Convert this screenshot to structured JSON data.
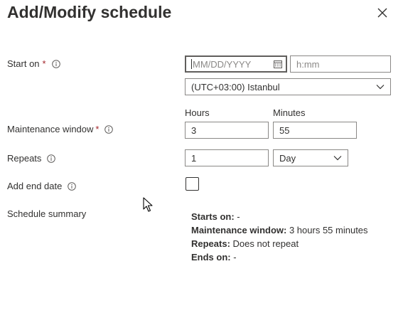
{
  "header": {
    "title": "Add/Modify schedule"
  },
  "start_on": {
    "label": "Start on",
    "required_mark": "*",
    "date_placeholder": "MM/DD/YYYY",
    "time_placeholder": "h:mm",
    "timezone": "(UTC+03:00) Istanbul"
  },
  "maintenance_window": {
    "label": "Maintenance window",
    "required_mark": "*",
    "hours_label": "Hours",
    "minutes_label": "Minutes",
    "hours_value": "3",
    "minutes_value": "55"
  },
  "repeats": {
    "label": "Repeats",
    "value": "1",
    "unit": "Day"
  },
  "end_date": {
    "label": "Add end date",
    "checked": false
  },
  "summary": {
    "label": "Schedule summary",
    "starts_on_key": "Starts on:",
    "starts_on_value": "-",
    "window_key": "Maintenance window:",
    "window_value": "3 hours 55 minutes",
    "repeats_key": "Repeats:",
    "repeats_value": "Does not repeat",
    "ends_on_key": "Ends on:",
    "ends_on_value": "-"
  },
  "colors": {
    "text": "#323130",
    "required": "#a4262c",
    "border": "#8a8886",
    "placeholder": "#8a8886"
  }
}
